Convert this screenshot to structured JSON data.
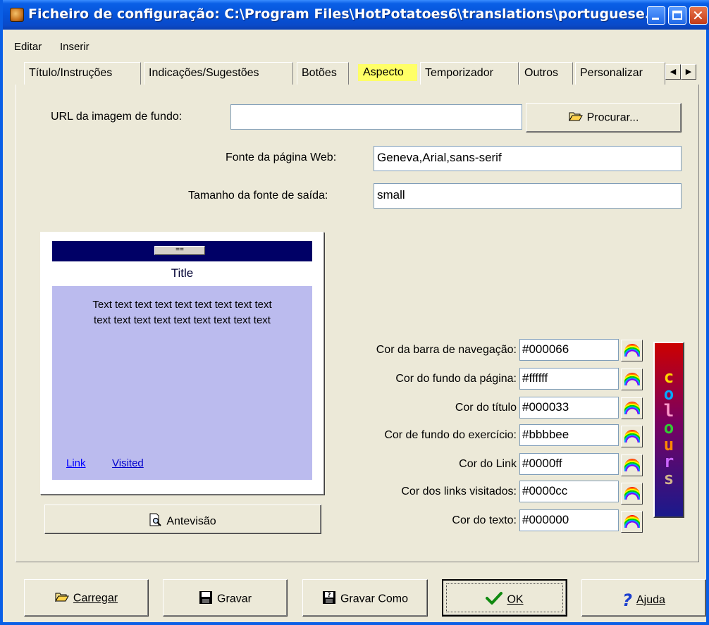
{
  "window": {
    "title": "Ficheiro de configuração: C:\\Program Files\\HotPotatoes6\\translations\\portuguese..."
  },
  "menu": [
    "Editar",
    "Inserir"
  ],
  "tabs": [
    {
      "label": "Título/Instruções",
      "active": false
    },
    {
      "label": "Indicações/Sugestões",
      "active": false
    },
    {
      "label": "Botões",
      "active": false
    },
    {
      "label": "Aspecto",
      "active": true
    },
    {
      "label": "Temporizador",
      "active": false
    },
    {
      "label": "Outros",
      "active": false
    },
    {
      "label": "Personalizar",
      "active": false
    }
  ],
  "background_url": {
    "label": "URL da imagem de fundo:",
    "value": "",
    "browse_label": "Procurar..."
  },
  "font": {
    "label": "Fonte da página Web:",
    "value": "Geneva,Arial,sans-serif"
  },
  "font_size": {
    "label": "Tamanho da fonte de saída:",
    "value": "small"
  },
  "preview": {
    "nav_button": "==",
    "title": "Title",
    "text_line1": "Text text text text text text text text text",
    "text_line2": "text text text text text text text text text",
    "link": "Link",
    "visited": "Visited",
    "button_label": "Antevisão"
  },
  "colors": [
    {
      "label": "Cor da barra de navegação:",
      "value": "#000066"
    },
    {
      "label": "Cor do fundo da página:",
      "value": "#ffffff"
    },
    {
      "label": "Cor do título",
      "value": "#000033"
    },
    {
      "label": "Cor de fundo do exercício:",
      "value": "#bbbbee"
    },
    {
      "label": "Cor do Link",
      "value": "#0000ff"
    },
    {
      "label": "Cor dos links visitados:",
      "value": "#0000cc"
    },
    {
      "label": "Cor do texto:",
      "value": "#000000"
    }
  ],
  "colours_logo": "colours",
  "buttons": {
    "load": "Carregar",
    "save": "Gravar",
    "save_as": "Gravar Como",
    "ok": "OK",
    "help": "Ajuda"
  }
}
